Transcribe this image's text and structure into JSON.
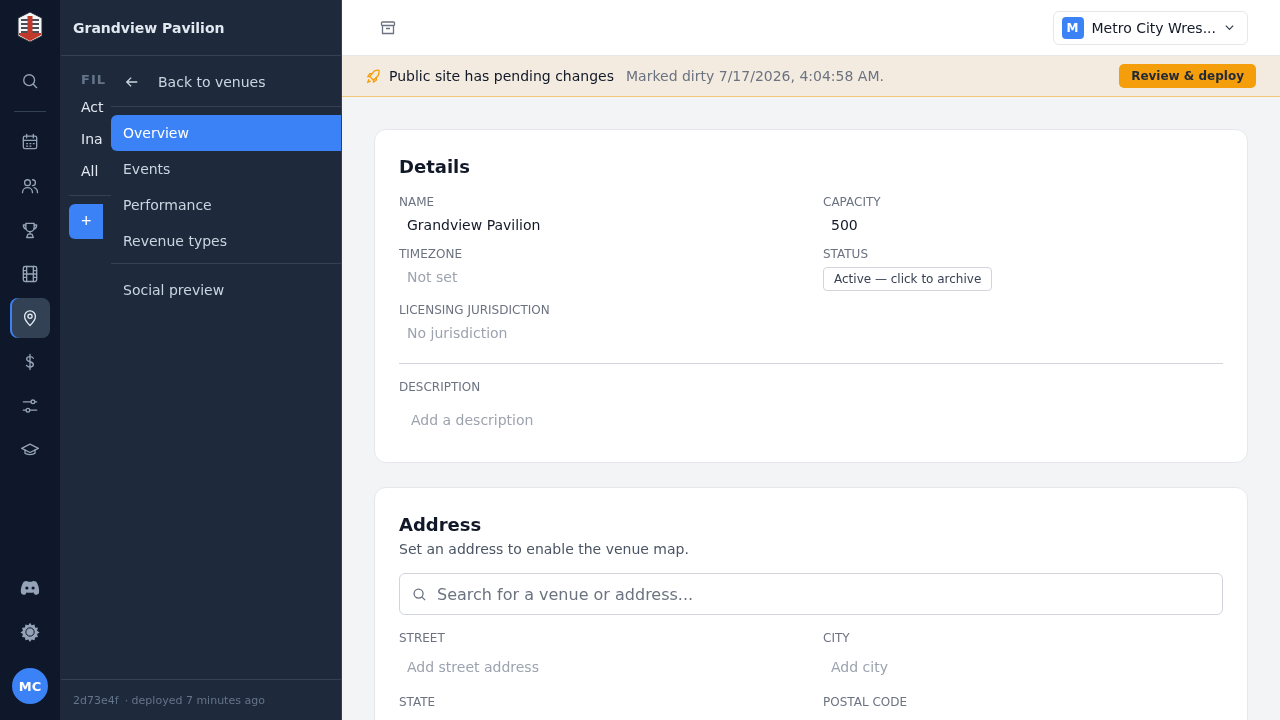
{
  "rail": {
    "items": [
      {
        "selected": false
      },
      {
        "selected": false
      },
      {
        "selected": false
      },
      {
        "selected": false
      },
      {
        "selected": false
      },
      {
        "selected": true
      },
      {
        "selected": false
      },
      {
        "selected": false
      },
      {
        "selected": false
      }
    ],
    "avatar": "MC"
  },
  "panel": {
    "title": "Grandview Pavilion",
    "behind": {
      "heading": "FIL",
      "items": [
        "Act",
        "Ina",
        "All"
      ],
      "add": "+"
    },
    "menu": {
      "back": "Back to venues",
      "items": [
        {
          "label": "Overview",
          "selected": true
        },
        {
          "label": "Events",
          "selected": false
        },
        {
          "label": "Performance",
          "selected": false
        },
        {
          "label": "Revenue types",
          "selected": false
        }
      ],
      "extra": [
        {
          "label": "Social preview",
          "selected": false
        }
      ]
    },
    "footer": {
      "commit": "2d73e4f",
      "deployed": "· deployed 7 minutes ago"
    }
  },
  "topbar": {
    "org_initial": "M",
    "org_name": "Metro City Wres..."
  },
  "banner": {
    "title": "Public site has pending changes",
    "detail": "Marked dirty 7/17/2026, 4:04:58 AM.",
    "button": "Review & deploy"
  },
  "details": {
    "title": "Details",
    "fields": [
      {
        "label": "NAME",
        "value": "Grandview Pavilion"
      },
      {
        "label": "CAPACITY",
        "value": "500"
      },
      {
        "label": "TIMEZONE",
        "placeholder": "Not set"
      },
      {
        "label": "STATUS",
        "value": "Active — click to archive",
        "kind": "button"
      },
      {
        "label": "LICENSING JURISDICTION",
        "placeholder": "No jurisdiction"
      }
    ],
    "description": {
      "label": "DESCRIPTION",
      "placeholder": "Add a description"
    }
  },
  "address": {
    "title": "Address",
    "subtitle": "Set an address to enable the venue map.",
    "search_placeholder": "Search for a venue or address...",
    "fields": [
      {
        "label": "STREET",
        "placeholder": "Add street address"
      },
      {
        "label": "CITY",
        "placeholder": "Add city"
      },
      {
        "label": "STATE"
      },
      {
        "label": "POSTAL CODE"
      }
    ]
  }
}
